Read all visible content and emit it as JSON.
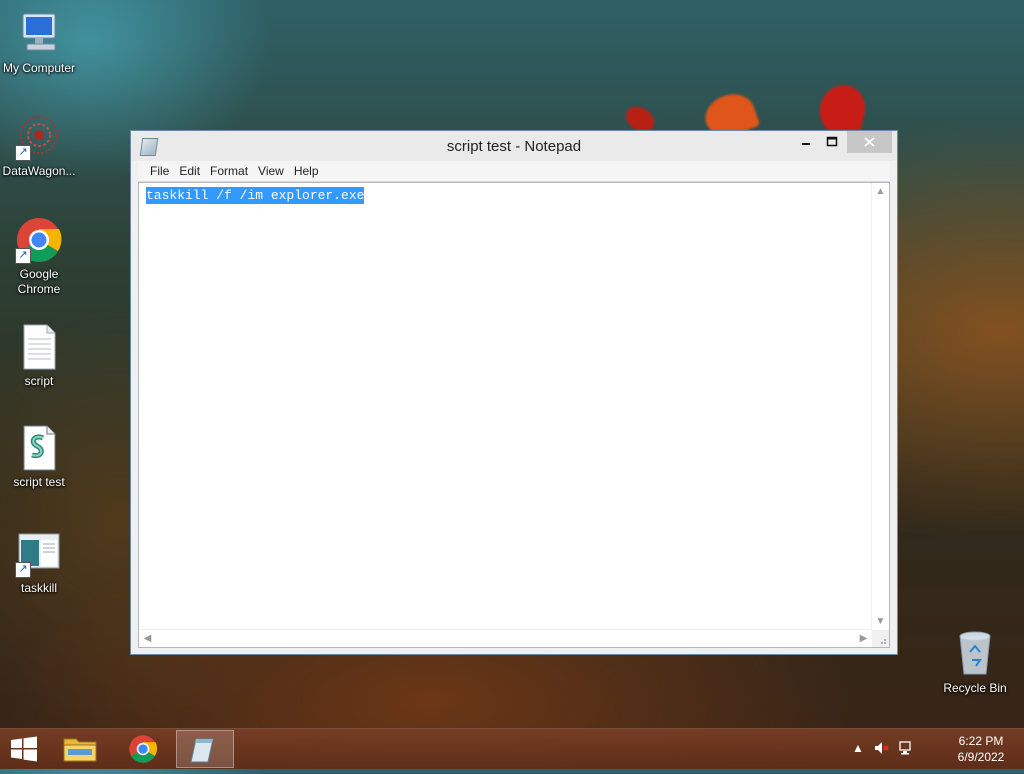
{
  "desktop": {
    "icons": [
      {
        "label": "My Computer"
      },
      {
        "label": "DataWagon..."
      },
      {
        "label": "Google Chrome"
      },
      {
        "label": "script"
      },
      {
        "label": "script test"
      },
      {
        "label": "taskkill"
      },
      {
        "label": "Recycle Bin"
      }
    ]
  },
  "notepad": {
    "title": "script test - Notepad",
    "menu": [
      "File",
      "Edit",
      "Format",
      "View",
      "Help"
    ],
    "content": "taskkill /f /im explorer.exe",
    "selected": true
  },
  "taskbar": {
    "items": [
      "start-button",
      "file-explorer",
      "google-chrome",
      "notepad"
    ],
    "active": "notepad",
    "clock": {
      "time": "6:22 PM",
      "date": "6/9/2022"
    }
  }
}
